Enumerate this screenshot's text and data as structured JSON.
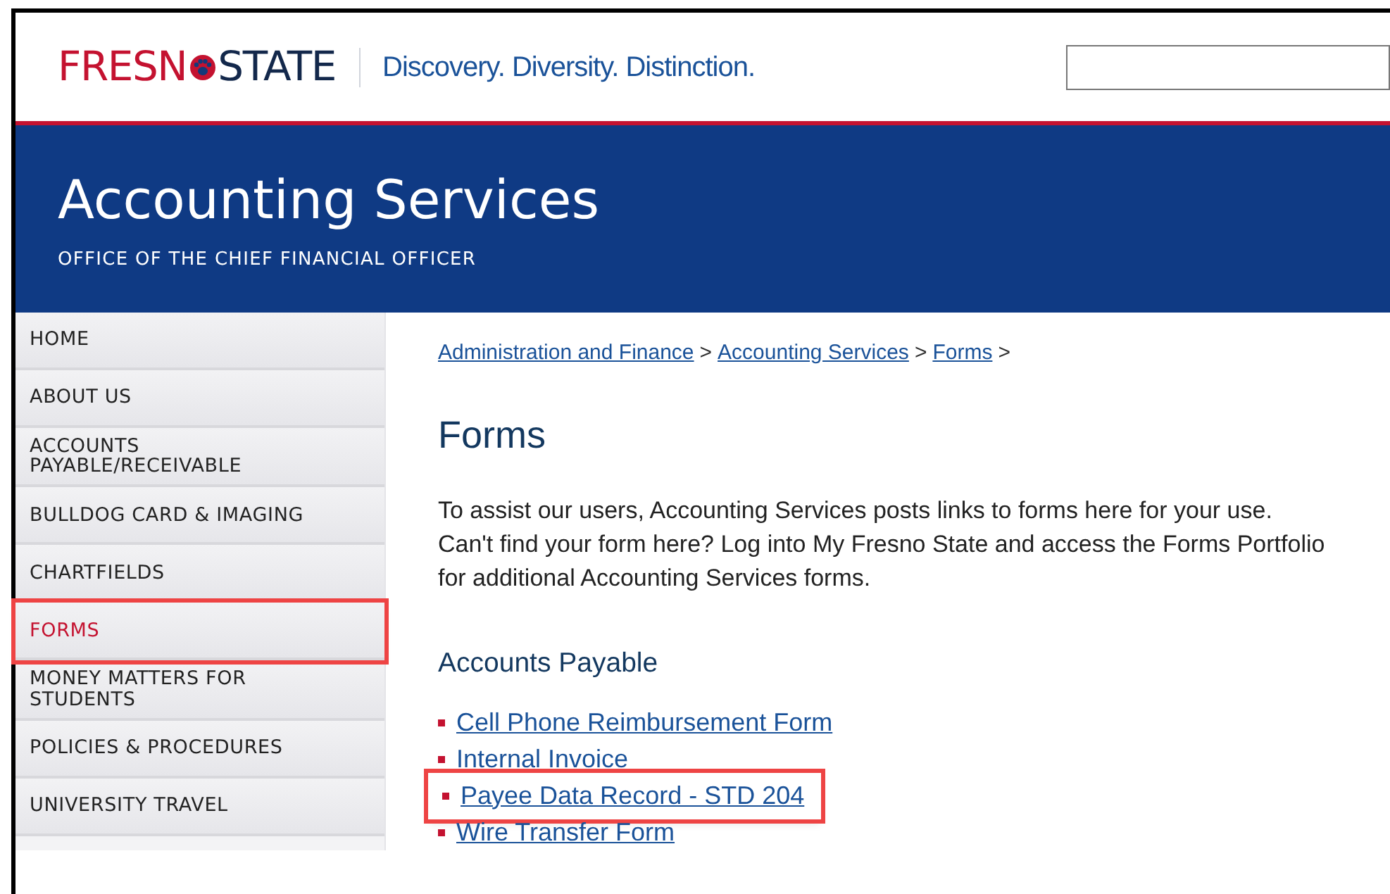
{
  "header": {
    "logo_left": "FRESN",
    "logo_right": "STATE",
    "tagline": "Discovery. Diversity. Distinction."
  },
  "banner": {
    "title": "Accounting Services",
    "subtitle": "OFFICE OF THE CHIEF FINANCIAL OFFICER"
  },
  "sidebar": {
    "items": [
      {
        "label": "HOME",
        "selected": false,
        "highlighted": false
      },
      {
        "label": "ABOUT US",
        "selected": false,
        "highlighted": false
      },
      {
        "label": "ACCOUNTS PAYABLE/RECEIVABLE",
        "selected": false,
        "highlighted": false
      },
      {
        "label": "BULLDOG CARD & IMAGING",
        "selected": false,
        "highlighted": false
      },
      {
        "label": "CHARTFIELDS",
        "selected": false,
        "highlighted": false
      },
      {
        "label": "FORMS",
        "selected": true,
        "highlighted": true
      },
      {
        "label": "MONEY MATTERS FOR STUDENTS",
        "selected": false,
        "highlighted": false
      },
      {
        "label": "POLICIES & PROCEDURES",
        "selected": false,
        "highlighted": false
      },
      {
        "label": "UNIVERSITY TRAVEL",
        "selected": false,
        "highlighted": false
      }
    ]
  },
  "breadcrumb": [
    {
      "label": "Administration and Finance"
    },
    {
      "label": "Accounting Services"
    },
    {
      "label": "Forms"
    }
  ],
  "breadcrumb_separator": ">",
  "page_title": "Forms",
  "intro": "To assist our users, Accounting Services posts links to forms here for your use. Can't find your form here? Log into My Fresno State and access the Forms Portfolio for additional Accounting Services forms.",
  "section": {
    "title": "Accounts Payable",
    "links": [
      {
        "label": "Cell Phone Reimbursement Form",
        "highlighted": false
      },
      {
        "label": "Internal Invoice",
        "highlighted": false
      },
      {
        "label": "Payee Data Record - STD 204",
        "highlighted": true
      },
      {
        "label": "Wire Transfer Form",
        "highlighted": false
      }
    ]
  }
}
